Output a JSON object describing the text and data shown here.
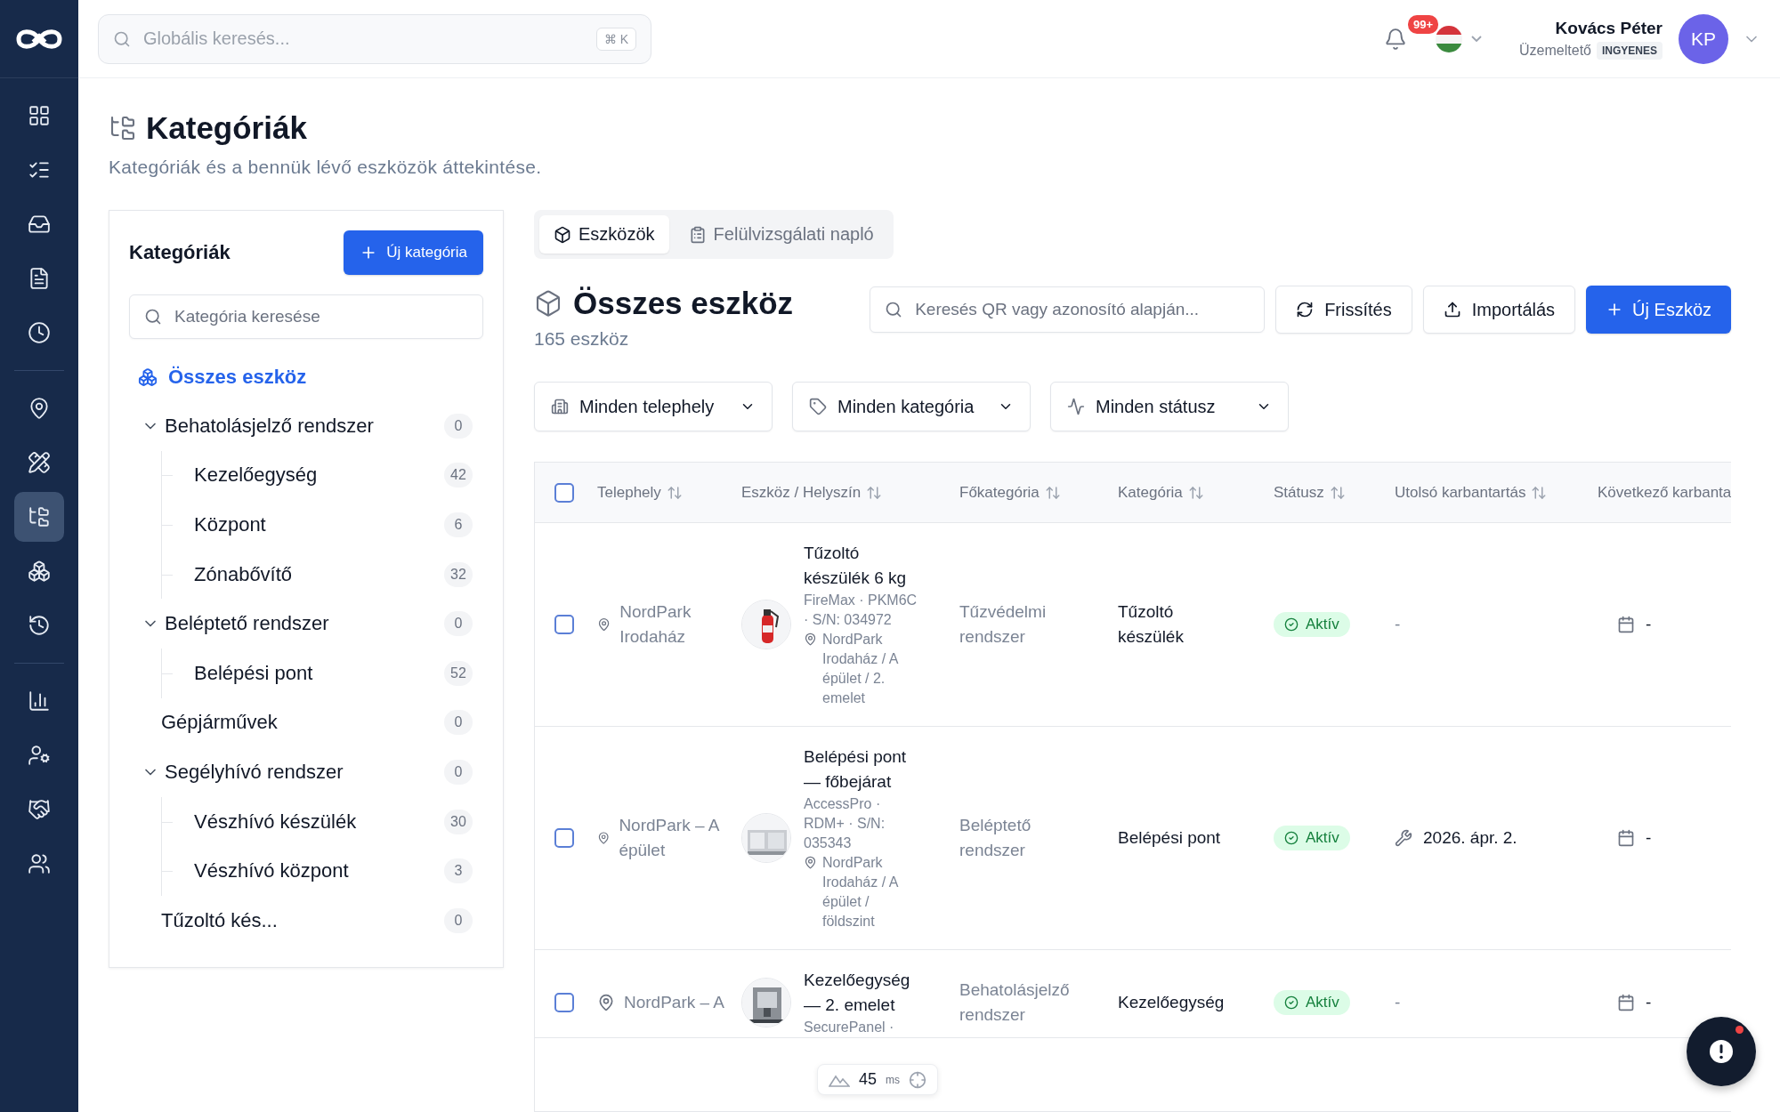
{
  "topbar": {
    "search_placeholder": "Globális keresés...",
    "shortcut": "⌘ K",
    "notification_count": "99+",
    "user": {
      "name": "Kovács Péter",
      "role": "Üzemeltető",
      "plan": "INGYENES",
      "initials": "KP"
    }
  },
  "nav_groups": [
    [
      {
        "selected": false
      },
      {
        "selected": false
      },
      {
        "selected": false
      },
      {
        "selected": false
      },
      {
        "selected": false
      }
    ],
    [
      {
        "selected": false
      },
      {
        "selected": false
      },
      {
        "selected": true
      },
      {
        "selected": false
      },
      {
        "selected": false
      }
    ],
    [
      {
        "selected": false
      },
      {
        "selected": false
      },
      {
        "selected": false
      },
      {
        "selected": false
      }
    ]
  ],
  "page": {
    "title": "Kategóriák",
    "subtitle": "Kategóriák és a bennük lévő eszközök áttekintése."
  },
  "category_panel": {
    "title": "Kategóriák",
    "new_button": "Új kategória",
    "search_placeholder": "Kategória keresése",
    "all_item": {
      "label": "Összes eszköz",
      "selected": true
    },
    "tree": [
      {
        "label": "Behatolásjelző rendszer",
        "count": "0",
        "expanded": true,
        "children": [
          {
            "label": "Kezelőegység",
            "count": "42"
          },
          {
            "label": "Központ",
            "count": "6"
          },
          {
            "label": "Zónabővítő",
            "count": "32"
          }
        ]
      },
      {
        "label": "Beléptető rendszer",
        "count": "0",
        "expanded": true,
        "children": [
          {
            "label": "Belépési pont",
            "count": "52"
          }
        ]
      },
      {
        "label": "Gépjárművek",
        "count": "0"
      },
      {
        "label": "Segélyhívó rendszer",
        "count": "0",
        "expanded": true,
        "children": [
          {
            "label": "Vészhívó készülék",
            "count": "30"
          },
          {
            "label": "Vészhívó központ",
            "count": "3"
          }
        ]
      },
      {
        "label": "Tűzoltó kés...",
        "count": "0"
      }
    ]
  },
  "tabs": [
    {
      "label": "Eszközök",
      "selected": true
    },
    {
      "label": "Felülvizsgálati napló",
      "selected": false
    }
  ],
  "assets": {
    "title": "Összes eszköz",
    "count": "165 eszköz",
    "search_placeholder": "Keresés QR vagy azonosító alapján...",
    "buttons": [
      {
        "label": "Frissítés",
        "kind": "refresh"
      },
      {
        "label": "Importálás",
        "kind": "import"
      },
      {
        "label": "Új Eszköz",
        "kind": "add"
      }
    ],
    "filters": [
      {
        "label": "Minden telephely",
        "kind": "site"
      },
      {
        "label": "Minden kategória",
        "kind": "category"
      },
      {
        "label": "Minden státusz",
        "kind": "status"
      }
    ]
  },
  "table": {
    "all_checked": false,
    "columns": [
      "Telephely",
      "Eszköz / Helyszín",
      "Főkategória",
      "Kategória",
      "Státusz",
      "Utolsó karbantartás",
      "Következő karbanta"
    ],
    "rows": [
      {
        "checked": false,
        "site": "NordPark Irodaház",
        "name": "Tűzoltó készülék 6 kg",
        "detail": "FireMax · PKM6C · S/N: 034972",
        "location": "NordPark Irodaház / A épület / 2. emelet",
        "main_category": "Tűzvédelmi rendszer",
        "category": "Tűzoltó készülék",
        "status": {
          "label": "Aktív",
          "kind": "active"
        },
        "last_maintenance": {
          "text": "-",
          "kind": "none"
        },
        "next_maintenance": "-"
      },
      {
        "checked": false,
        "site": "NordPark – A épület",
        "name": "Belépési pont — főbejárat",
        "detail": "AccessPro · RDM+ · S/N: 035343",
        "location": "NordPark Irodaház / A épület / földszint",
        "main_category": "Beléptető rendszer",
        "category": "Belépési pont",
        "status": {
          "label": "Aktív",
          "kind": "active"
        },
        "last_maintenance": {
          "text": "2026. ápr. 2.",
          "kind": "date"
        },
        "next_maintenance": "-"
      },
      {
        "checked": false,
        "site": "NordPark – A",
        "name": "Kezelőegység — 2. emelet",
        "detail": "SecurePanel ·",
        "main_category": "Behatolásjelző rendszer",
        "category": "Kezelőegység",
        "status": {
          "label": "Aktív",
          "kind": "active"
        },
        "last_maintenance": {
          "text": "-",
          "kind": "none"
        },
        "next_maintenance": "-"
      }
    ]
  },
  "dev_toolbar": {
    "value": "45",
    "unit": "ms"
  }
}
